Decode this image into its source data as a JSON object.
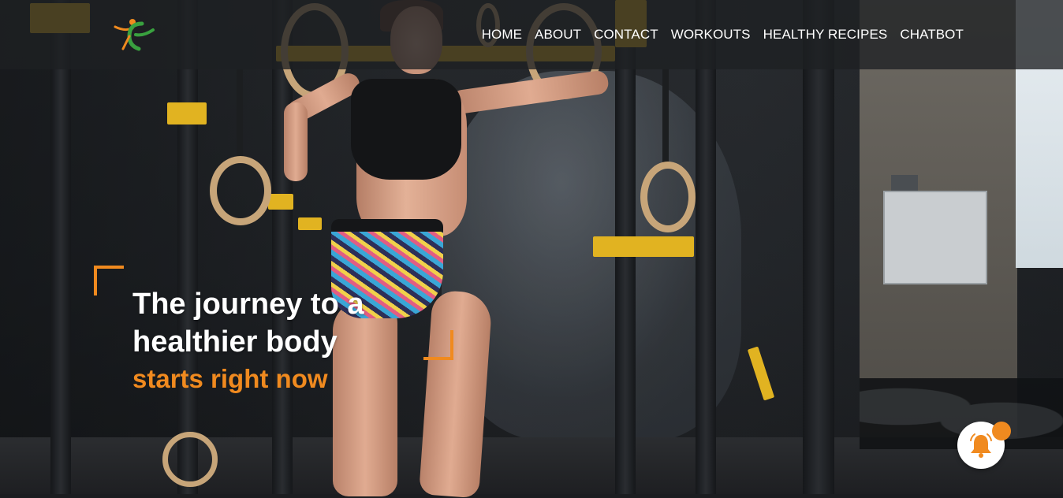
{
  "nav": {
    "items": [
      {
        "label": "HOME"
      },
      {
        "label": "ABOUT"
      },
      {
        "label": "CONTACT"
      },
      {
        "label": "WORKOUTS"
      },
      {
        "label": "HEALTHY RECIPES"
      },
      {
        "label": "CHATBOT"
      }
    ]
  },
  "hero": {
    "headline_line1": "The journey to a",
    "headline_line2": "healthier body",
    "subline": "starts right now"
  },
  "colors": {
    "accent": "#f08a1f",
    "navbar_bg": "rgba(30,32,35,0.78)",
    "text": "#ffffff"
  },
  "icons": {
    "logo": "fitness-person-logo-icon",
    "bell": "bell-icon"
  }
}
